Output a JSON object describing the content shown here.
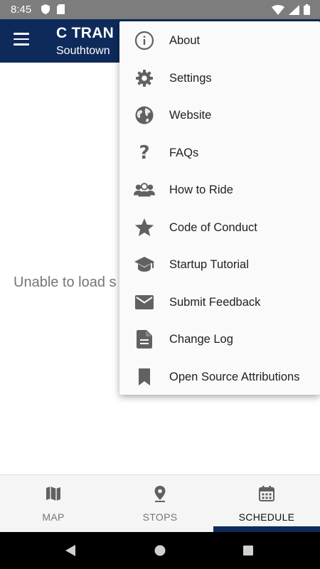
{
  "status_bar": {
    "time": "8:45",
    "icons": [
      "shield-icon",
      "sd-card-icon",
      "wifi-icon",
      "signal-icon",
      "battery-icon"
    ]
  },
  "app_bar": {
    "title": "C TRAN",
    "subtitle": "Southtown",
    "menu_icon": "hamburger-menu-icon",
    "background": "#0d2a5a"
  },
  "main": {
    "message": "Unable to load s"
  },
  "overflow_menu": {
    "items": [
      {
        "label": "About",
        "icon": "info-icon"
      },
      {
        "label": "Settings",
        "icon": "gear-icon"
      },
      {
        "label": "Website",
        "icon": "globe-icon"
      },
      {
        "label": "FAQs",
        "icon": "question-icon"
      },
      {
        "label": "How to Ride",
        "icon": "people-icon"
      },
      {
        "label": "Code of Conduct",
        "icon": "star-icon"
      },
      {
        "label": "Startup Tutorial",
        "icon": "graduation-cap-icon"
      },
      {
        "label": "Submit Feedback",
        "icon": "email-icon"
      },
      {
        "label": "Change Log",
        "icon": "document-icon"
      },
      {
        "label": "Open Source Attributions",
        "icon": "bookmark-icon"
      }
    ]
  },
  "bottom_nav": {
    "tabs": [
      {
        "label": "MAP",
        "icon": "map-icon",
        "active": false
      },
      {
        "label": "STOPS",
        "icon": "location-pin-icon",
        "active": false
      },
      {
        "label": "SCHEDULE",
        "icon": "calendar-icon",
        "active": true
      }
    ]
  },
  "system_nav": {
    "buttons": [
      "back-icon",
      "home-icon",
      "recents-icon"
    ]
  },
  "colors": {
    "status_bar": "#7d7d7d",
    "primary": "#0d2a5a",
    "icon_gray": "#616161"
  }
}
